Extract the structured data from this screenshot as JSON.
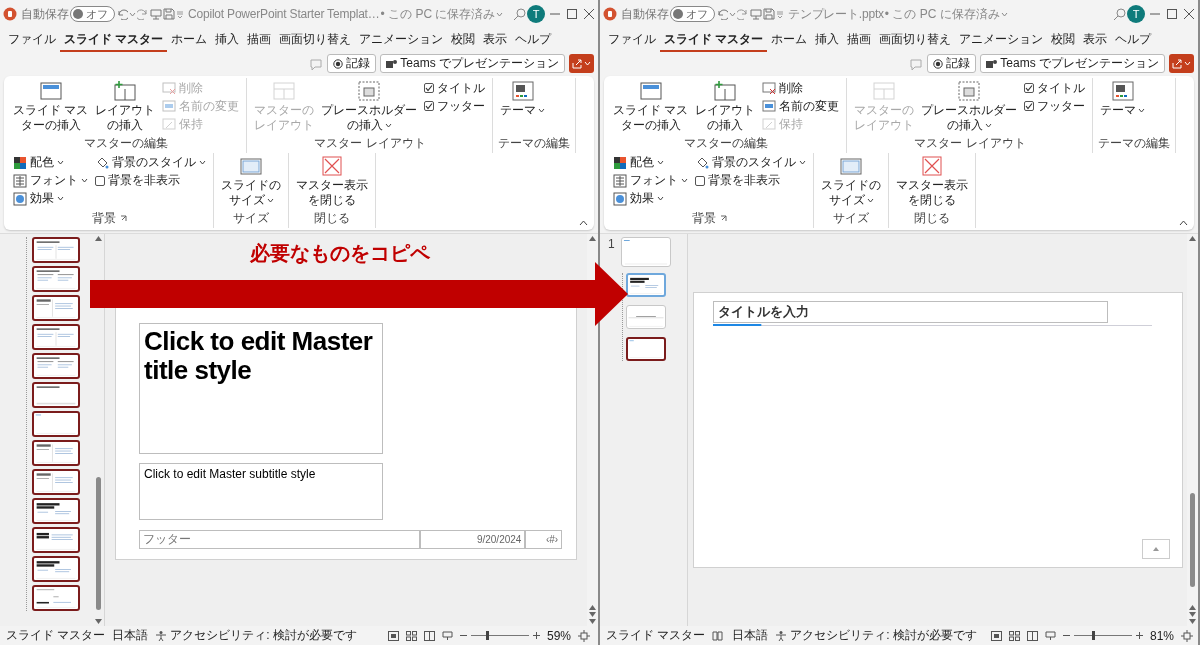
{
  "annotation": {
    "text": "必要なものをコピペ"
  },
  "windows": [
    {
      "title_bar": {
        "autosave": {
          "label": "自動保存",
          "on": false,
          "state_text": "オフ"
        },
        "document_title": "Copilot PowerPoint Starter Templat…",
        "save_status": "• この PC に保存済み",
        "account_initial": "T"
      },
      "tabs": [
        {
          "label": "ファイル",
          "selected": false
        },
        {
          "label": "スライド マスター",
          "selected": true
        },
        {
          "label": "ホーム",
          "selected": false
        },
        {
          "label": "挿入",
          "selected": false
        },
        {
          "label": "描画",
          "selected": false
        },
        {
          "label": "画面切り替え",
          "selected": false
        },
        {
          "label": "アニメーション",
          "selected": false
        },
        {
          "label": "校閲",
          "selected": false
        },
        {
          "label": "表示",
          "selected": false
        },
        {
          "label": "ヘルプ",
          "selected": false
        }
      ],
      "record_button": "記録",
      "teams_button": "Teams でプレゼンテーション",
      "ribbon": {
        "groups": [
          {
            "label": "マスターの編集",
            "items": [
              {
                "kind": "large",
                "lines": [
                  "スライド マス",
                  "ターの挿入"
                ],
                "disabled": false,
                "dropdown": false
              },
              {
                "kind": "large",
                "lines": [
                  "レイアウト",
                  "の挿入"
                ],
                "disabled": false,
                "dropdown": false
              },
              {
                "kind": "stack",
                "rows": [
                  {
                    "kind": "button",
                    "label": "削除",
                    "disabled": true,
                    "dropdown": false
                  },
                  {
                    "kind": "button",
                    "label": "名前の変更",
                    "disabled": true,
                    "dropdown": false
                  },
                  {
                    "kind": "button",
                    "label": "保持",
                    "disabled": true,
                    "dropdown": false
                  }
                ]
              }
            ]
          },
          {
            "label": "マスター レイアウト",
            "items": [
              {
                "kind": "large",
                "lines": [
                  "マスターの",
                  "レイアウト"
                ],
                "disabled": true,
                "dropdown": false
              },
              {
                "kind": "large",
                "lines": [
                  "プレースホルダー",
                  "の挿入"
                ],
                "disabled": false,
                "dropdown": true
              },
              {
                "kind": "stack",
                "rows": [
                  {
                    "kind": "checkbox",
                    "label": "タイトル",
                    "checked": true
                  },
                  {
                    "kind": "checkbox",
                    "label": "フッター",
                    "checked": true
                  }
                ]
              }
            ]
          },
          {
            "label": "テーマの編集",
            "items": [
              {
                "kind": "large",
                "lines": [
                  "テーマ"
                ],
                "disabled": false,
                "dropdown": true
              }
            ]
          },
          {
            "label": "背景",
            "launcher": true,
            "items": [
              {
                "kind": "stack",
                "rows": [
                  {
                    "kind": "button",
                    "label": "配色",
                    "disabled": false,
                    "dropdown": true
                  },
                  {
                    "kind": "button",
                    "label": "フォント",
                    "disabled": false,
                    "dropdown": true
                  },
                  {
                    "kind": "button",
                    "label": "効果",
                    "disabled": false,
                    "dropdown": true
                  }
                ]
              },
              {
                "kind": "stack",
                "rows": [
                  {
                    "kind": "button",
                    "label": "背景のスタイル",
                    "disabled": false,
                    "dropdown": true
                  },
                  {
                    "kind": "checkbox",
                    "label": "背景を非表示",
                    "checked": false
                  }
                ]
              }
            ]
          },
          {
            "label": "サイズ",
            "items": [
              {
                "kind": "large",
                "lines": [
                  "スライドの",
                  "サイズ"
                ],
                "disabled": false,
                "dropdown": true
              }
            ]
          },
          {
            "label": "閉じる",
            "items": [
              {
                "kind": "large",
                "lines": [
                  "マスター表示",
                  "を閉じる"
                ],
                "disabled": false,
                "dropdown": false
              }
            ]
          }
        ]
      },
      "thumbnail_pane": {
        "layouts": [
          {
            "kind": "two-content",
            "selected": true
          },
          {
            "kind": "comparison",
            "selected": true
          },
          {
            "kind": "caption",
            "selected": true
          },
          {
            "kind": "two-content",
            "selected": true
          },
          {
            "kind": "comparison",
            "selected": true
          },
          {
            "kind": "title-only",
            "selected": true
          },
          {
            "kind": "blank",
            "selected": true
          },
          {
            "kind": "caption",
            "selected": true
          },
          {
            "kind": "caption",
            "selected": true
          },
          {
            "kind": "title-slide",
            "selected": true
          },
          {
            "kind": "big-title",
            "selected": true
          },
          {
            "kind": "title-slide",
            "selected": true
          },
          {
            "kind": "closing",
            "selected": true
          }
        ]
      },
      "slide": {
        "kind": "title-master",
        "title": "Click to edit Master title style",
        "subtitle": "Click to edit Master subtitle style",
        "footer": "フッター",
        "date": "9/20/2024",
        "number": "‹#›"
      },
      "status_bar": {
        "view": "スライド マスター",
        "proofing_icon": false,
        "language": "日本語",
        "accessibility": "アクセシビリティ: 検討が必要です",
        "zoom": {
          "level": 0.27,
          "reading": "59%"
        }
      }
    },
    {
      "title_bar": {
        "autosave": {
          "label": "自動保存",
          "on": false,
          "state_text": "オフ"
        },
        "document_title": "テンプレート.pptx",
        "save_status": "• この PC に保存済み",
        "account_initial": "T"
      },
      "tabs": [
        {
          "label": "ファイル",
          "selected": false
        },
        {
          "label": "スライド マスター",
          "selected": true
        },
        {
          "label": "ホーム",
          "selected": false
        },
        {
          "label": "挿入",
          "selected": false
        },
        {
          "label": "描画",
          "selected": false
        },
        {
          "label": "画面切り替え",
          "selected": false
        },
        {
          "label": "アニメーション",
          "selected": false
        },
        {
          "label": "校閲",
          "selected": false
        },
        {
          "label": "表示",
          "selected": false
        },
        {
          "label": "ヘルプ",
          "selected": false
        }
      ],
      "record_button": "記録",
      "teams_button": "Teams でプレゼンテーション",
      "ribbon": {
        "groups": [
          {
            "label": "マスターの編集",
            "items": [
              {
                "kind": "large",
                "lines": [
                  "スライド マス",
                  "ターの挿入"
                ],
                "disabled": false,
                "dropdown": false
              },
              {
                "kind": "large",
                "lines": [
                  "レイアウト",
                  "の挿入"
                ],
                "disabled": false,
                "dropdown": false
              },
              {
                "kind": "stack",
                "rows": [
                  {
                    "kind": "button",
                    "label": "削除",
                    "disabled": false,
                    "dropdown": false
                  },
                  {
                    "kind": "button",
                    "label": "名前の変更",
                    "disabled": false,
                    "dropdown": false
                  },
                  {
                    "kind": "button",
                    "label": "保持",
                    "disabled": true,
                    "dropdown": false
                  }
                ]
              }
            ]
          },
          {
            "label": "マスター レイアウト",
            "items": [
              {
                "kind": "large",
                "lines": [
                  "マスターの",
                  "レイアウト"
                ],
                "disabled": true,
                "dropdown": false
              },
              {
                "kind": "large",
                "lines": [
                  "プレースホルダー",
                  "の挿入"
                ],
                "disabled": false,
                "dropdown": true
              },
              {
                "kind": "stack",
                "rows": [
                  {
                    "kind": "checkbox",
                    "label": "タイトル",
                    "checked": true
                  },
                  {
                    "kind": "checkbox",
                    "label": "フッター",
                    "checked": true
                  }
                ]
              }
            ]
          },
          {
            "label": "テーマの編集",
            "items": [
              {
                "kind": "large",
                "lines": [
                  "テーマ"
                ],
                "disabled": false,
                "dropdown": true
              }
            ]
          },
          {
            "label": "背景",
            "launcher": true,
            "items": [
              {
                "kind": "stack",
                "rows": [
                  {
                    "kind": "button",
                    "label": "配色",
                    "disabled": false,
                    "dropdown": true
                  },
                  {
                    "kind": "button",
                    "label": "フォント",
                    "disabled": false,
                    "dropdown": true
                  },
                  {
                    "kind": "button",
                    "label": "効果",
                    "disabled": false,
                    "dropdown": true
                  }
                ]
              },
              {
                "kind": "stack",
                "rows": [
                  {
                    "kind": "button",
                    "label": "背景のスタイル",
                    "disabled": false,
                    "dropdown": true
                  },
                  {
                    "kind": "checkbox",
                    "label": "背景を非表示",
                    "checked": false
                  }
                ]
              }
            ]
          },
          {
            "label": "サイズ",
            "items": [
              {
                "kind": "large",
                "lines": [
                  "スライドの",
                  "サイズ"
                ],
                "disabled": false,
                "dropdown": true
              }
            ]
          },
          {
            "label": "閉じる",
            "items": [
              {
                "kind": "large",
                "lines": [
                  "マスター表示",
                  "を閉じる"
                ],
                "disabled": false,
                "dropdown": false
              }
            ]
          }
        ]
      },
      "thumbnail_pane": {
        "master_number": "1",
        "master": {
          "selected": false
        },
        "layouts": [
          {
            "kind": "title-slide",
            "selected": false,
            "highlighted": true
          },
          {
            "kind": "section",
            "selected": false,
            "highlighted": false
          },
          {
            "kind": "blank",
            "selected": true,
            "highlighted": false
          }
        ]
      },
      "slide": {
        "kind": "title-only",
        "title": "タイトルを入力"
      },
      "status_bar": {
        "view": "スライド マスター",
        "proofing_icon": true,
        "language": "日本語",
        "accessibility": "アクセシビリティ: 検討が必要です",
        "zoom": {
          "level": 0.33,
          "reading": "81%"
        }
      }
    }
  ]
}
